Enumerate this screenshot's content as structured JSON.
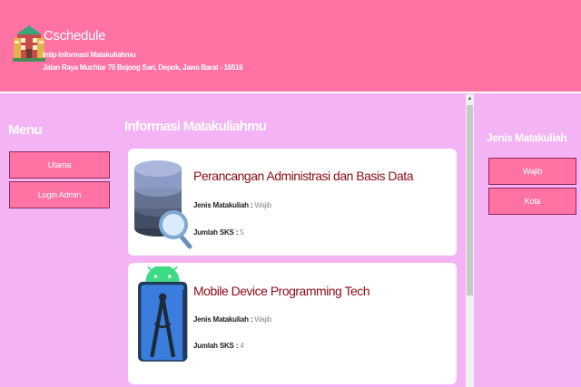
{
  "header": {
    "app_name": "Cschedule",
    "tagline": "Intip Informasi Matakuliahmu",
    "address": "Jalan Raya Muchtar 70 Bojong Sari, Depok, Jawa Barat - 16516",
    "logo_icon": "building-icon"
  },
  "sidebar": {
    "title": "Menu",
    "items": [
      {
        "label": "Utama"
      },
      {
        "label": "Login Admin"
      }
    ]
  },
  "main": {
    "title": "Informasi Matakuliahmu",
    "courses": [
      {
        "icon": "database-search-icon",
        "name": "Perancangan Administrasi dan Basis Data",
        "type_label": "Jenis Matakuliah :",
        "type_value": "Wajib",
        "sks_label": "Jumlah SKS :",
        "sks_value": "5"
      },
      {
        "icon": "android-studio-icon",
        "name": "Mobile Device Programming Tech",
        "type_label": "Jenis Matakuliah :",
        "type_value": "Wajib",
        "sks_label": "Jumlah SKS :",
        "sks_value": "4"
      }
    ]
  },
  "right_panel": {
    "title": "Jenis Matakuliah",
    "items": [
      {
        "label": "Wajib"
      },
      {
        "label": "Kota"
      }
    ]
  },
  "colors": {
    "header_bg": "#ff72a4",
    "page_bg": "#f3b3f4",
    "button_bg": "#ff72a4",
    "course_title": "#8b0d17"
  }
}
